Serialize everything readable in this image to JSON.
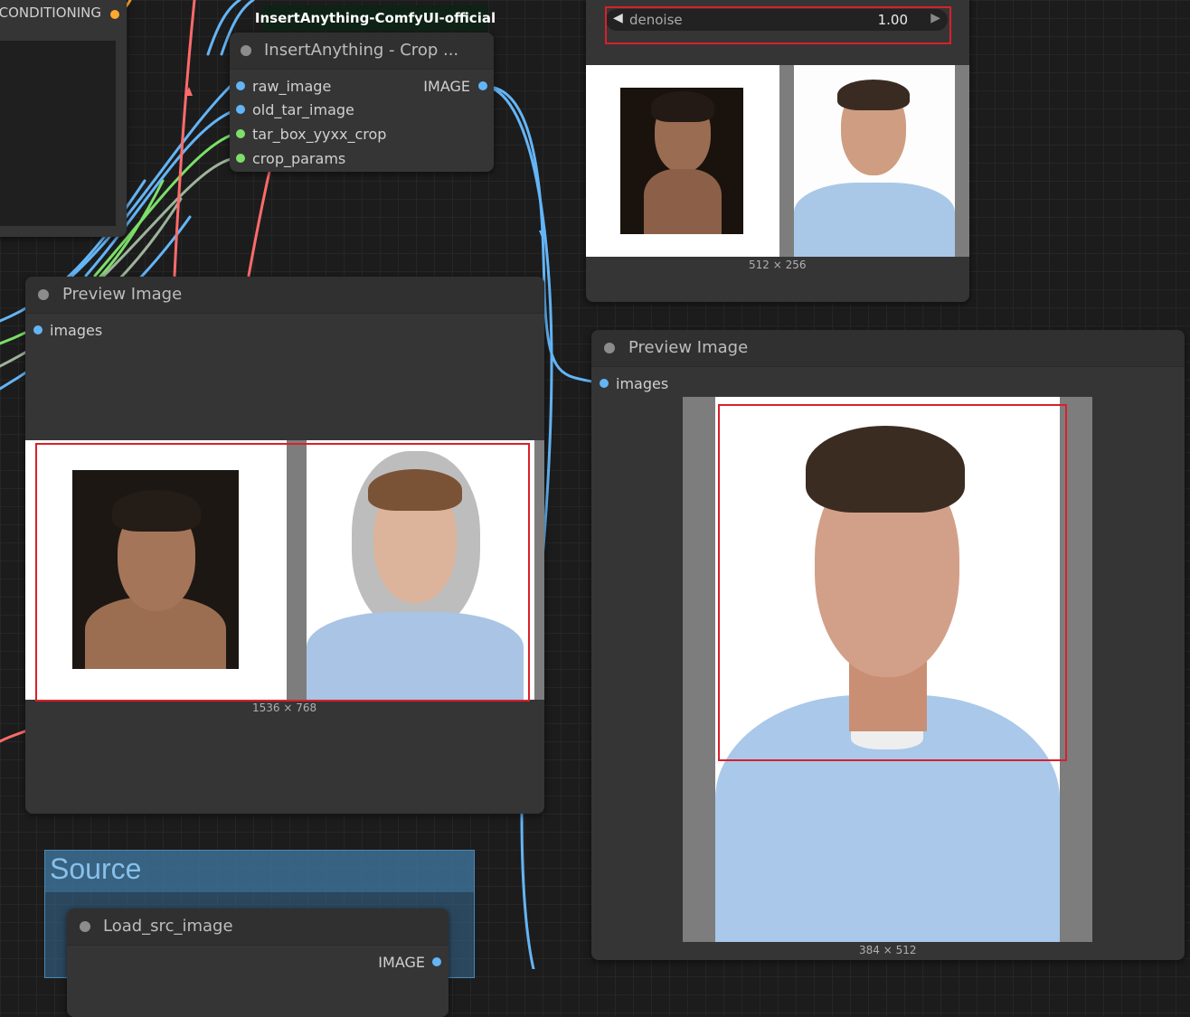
{
  "conditioning_node": {
    "output_label": "CONDITIONING"
  },
  "crop_node": {
    "group_label": "InsertAnything-ComfyUI-official",
    "title": "InsertAnything - Crop ...",
    "inputs": [
      "raw_image",
      "old_tar_image",
      "tar_box_yyxx_crop",
      "crop_params"
    ],
    "output": "IMAGE"
  },
  "denoise_node": {
    "widget_label": "denoise",
    "widget_value": "1.00",
    "image_size": "512 × 256"
  },
  "preview_left": {
    "title": "Preview Image",
    "input": "images",
    "image_size": "1536 × 768"
  },
  "preview_right": {
    "title": "Preview Image",
    "input": "images",
    "image_size": "384 × 512"
  },
  "source_group": {
    "label": "Source",
    "node_title": "Load_src_image",
    "output": "IMAGE"
  },
  "colors": {
    "canvas": "#1c1c1c",
    "node": "#353535",
    "image_wire": "#64b5f6",
    "latent_wire": "#ff6b6b",
    "green_wire": "#7ddf6a",
    "highlight": "#d9202b"
  }
}
